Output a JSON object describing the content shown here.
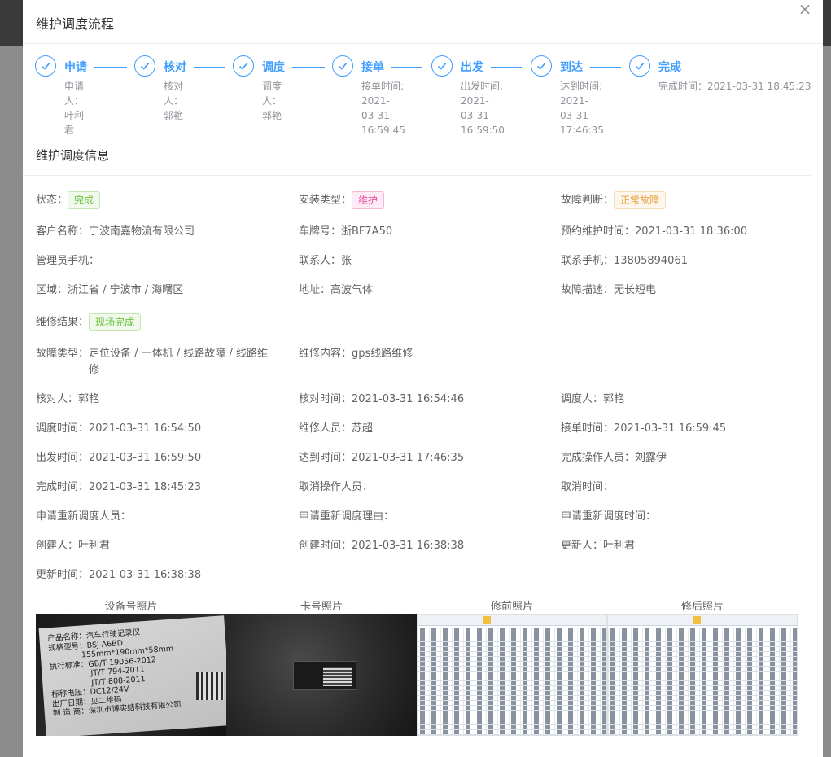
{
  "dialog": {
    "title": "维护调度流程",
    "close_symbol": "×"
  },
  "steps": [
    {
      "title": "申请",
      "desc": [
        "申请人：叶利君"
      ]
    },
    {
      "title": "核对",
      "desc": [
        "核对人：郭艳"
      ]
    },
    {
      "title": "调度",
      "desc": [
        "调度人：郭艳"
      ]
    },
    {
      "title": "接单",
      "desc": [
        "接单时间:",
        "2021-03-31",
        "16:59:45"
      ]
    },
    {
      "title": "出发",
      "desc": [
        "出发时间:",
        "2021-03-31",
        "16:59:50"
      ]
    },
    {
      "title": "到达",
      "desc": [
        "达到时间:",
        "2021-03-31",
        "17:46:35"
      ]
    },
    {
      "title": "完成",
      "desc": [
        "完成时间：2021-03-31 18:45:23"
      ]
    }
  ],
  "info": {
    "section_title": "维护调度信息",
    "status_label": "状态：",
    "status_value": "完成",
    "install_type_label": "安装类型：",
    "install_type_value": "维护",
    "fault_judge_label": "故障判断：",
    "fault_judge_value": "正常故障",
    "customer_label": "客户名称：",
    "customer_value": "宁波南嘉物流有限公司",
    "plate_label": "车牌号：",
    "plate_value": "浙BF7A50",
    "appointment_label": "预约维护时间：",
    "appointment_value": "2021-03-31 18:36:00",
    "admin_phone_label": "管理员手机：",
    "admin_phone_value": "",
    "contact_label": "联系人：",
    "contact_value": "张",
    "contact_phone_label": "联系手机：",
    "contact_phone_value": "13805894061",
    "region_label": "区域：",
    "region_value": "浙江省 / 宁波市 / 海曙区",
    "address_label": "地址：",
    "address_value": "高波气体",
    "fault_desc_label": "故障描述：",
    "fault_desc_value": "无长短电",
    "result_label": "维修结果：",
    "result_value": "现场完成",
    "fault_type_label": "故障类型：",
    "fault_type_value": "定位设备 / 一体机 / 线路故障 / 线路维修",
    "repair_content_label": "维修内容：",
    "repair_content_value": "gps线路维修",
    "checker_label": "核对人：",
    "checker_value": "郭艳",
    "check_time_label": "核对时间：",
    "check_time_value": "2021-03-31 16:54:46",
    "dispatcher_label": "调度人：",
    "dispatcher_value": "郭艳",
    "dispatch_time_label": "调度时间：",
    "dispatch_time_value": "2021-03-31 16:54:50",
    "repairer_label": "维修人员：",
    "repairer_value": "苏超",
    "accept_time_label": "接单时间：",
    "accept_time_value": "2021-03-31 16:59:45",
    "depart_time_label": "出发时间：",
    "depart_time_value": "2021-03-31 16:59:50",
    "arrive_time_label": "达到时间：",
    "arrive_time_value": "2021-03-31 17:46:35",
    "finish_operator_label": "完成操作人员：",
    "finish_operator_value": "刘露伊",
    "finish_time_label": "完成时间：",
    "finish_time_value": "2021-03-31 18:45:23",
    "cancel_operator_label": "取消操作人员：",
    "cancel_operator_value": "",
    "cancel_time_label": "取消时间：",
    "cancel_time_value": "",
    "redispatch_person_label": "申请重新调度人员：",
    "redispatch_person_value": "",
    "redispatch_reason_label": "申请重新调度理由：",
    "redispatch_reason_value": "",
    "redispatch_time_label": "申请重新调度时间：",
    "redispatch_time_value": "",
    "creator_label": "创建人：",
    "creator_value": "叶利君",
    "create_time_label": "创建时间：",
    "create_time_value": "2021-03-31 16:38:38",
    "updater_label": "更新人：",
    "updater_value": "叶利君",
    "update_time_label": "更新时间：",
    "update_time_value": "2021-03-31 16:38:38"
  },
  "photos": {
    "labels": [
      "设备号照片",
      "卡号照片",
      "修前照片",
      "修后照片"
    ],
    "device_plate_lines": [
      "产品名称：汽车行驶记录仪",
      "规格型号：BSJ-A6BD",
      "155mm*190mm*58mm",
      "执行标准：GB/T 19056-2012",
      "JT/T 794-2011",
      "JT/T 808-2011",
      "标称电压：DC12/24V",
      "出厂日期：见二维码",
      "制 造 商：深圳市博实结科技有限公司"
    ]
  },
  "colors": {
    "primary": "#409eff",
    "success": "#67c23a",
    "pink": "#e8479b",
    "warning": "#e6a23c"
  }
}
